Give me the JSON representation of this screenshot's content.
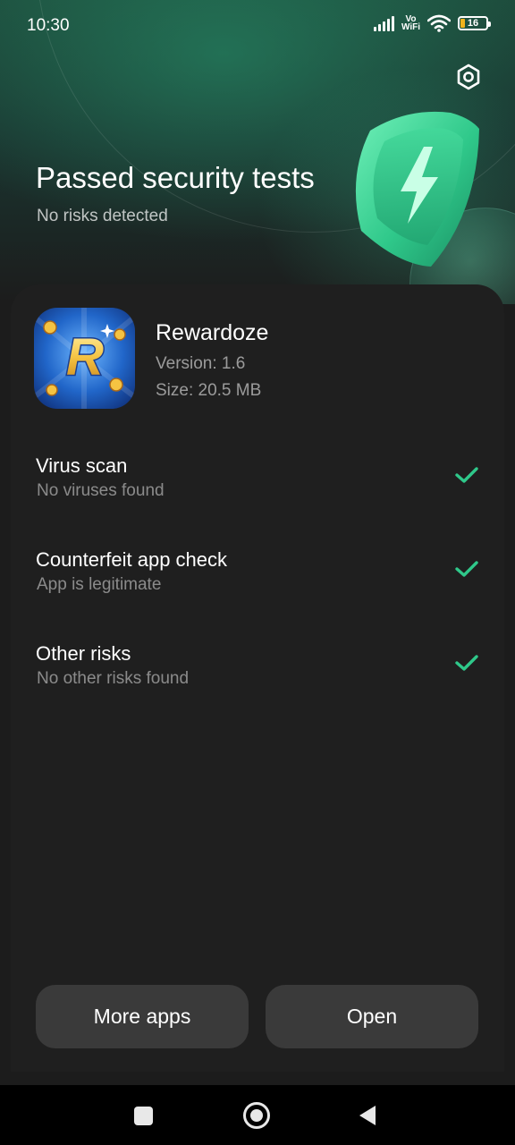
{
  "status_bar": {
    "time": "10:30",
    "network_label_top": "Vo",
    "network_label_bottom": "WiFi",
    "battery_level": "16",
    "icons": [
      "signal-icon",
      "vowifi-icon",
      "wifi-icon",
      "battery-icon"
    ]
  },
  "header": {
    "title": "Passed security tests",
    "subtitle": "No risks detected",
    "settings_icon": "gear-icon",
    "illustration": "shield-lightning-icon"
  },
  "app": {
    "name": "Rewardoze",
    "version": "Version: 1.6",
    "size": "Size: 20.5 MB",
    "icon": "rewardoze-app-icon"
  },
  "checks": [
    {
      "title": "Virus scan",
      "subtitle": "No viruses found",
      "status_icon": "checkmark-icon"
    },
    {
      "title": "Counterfeit app check",
      "subtitle": "App is legitimate",
      "status_icon": "checkmark-icon"
    },
    {
      "title": "Other risks",
      "subtitle": "No other risks found",
      "status_icon": "checkmark-icon"
    }
  ],
  "actions": {
    "more_apps_label": "More apps",
    "open_label": "Open"
  },
  "nav_bar": {
    "icons": [
      "recents-square-icon",
      "home-circle-icon",
      "back-triangle-icon"
    ]
  },
  "colors": {
    "accent_green": "#2fc88a",
    "background": "#1c1c1c",
    "button_bg": "#3a3a3a",
    "battery_low": "#f2b31c"
  }
}
